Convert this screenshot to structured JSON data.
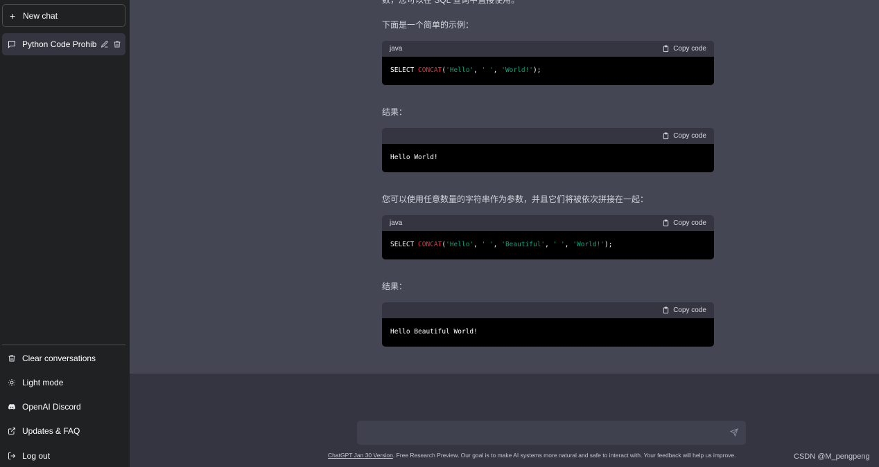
{
  "sidebar": {
    "new_chat_label": "New chat",
    "conversation_title": "Python Code Prohibit",
    "links": [
      {
        "label": "Clear conversations",
        "icon": "trash-icon"
      },
      {
        "label": "Light mode",
        "icon": "sun-icon"
      },
      {
        "label": "OpenAI Discord",
        "icon": "discord-icon"
      },
      {
        "label": "Updates & FAQ",
        "icon": "external-link-icon"
      },
      {
        "label": "Log out",
        "icon": "logout-icon"
      }
    ]
  },
  "main": {
    "partial_top_text": "数，您可以在 SQL 查询中直接使用。",
    "intro_example": "下面是一个简单的示例：",
    "result_label_1": "结果：",
    "multi_args_text": "您可以使用任意数量的字符串作为参数，并且它们将被依次拼接在一起：",
    "result_label_2": "结果：",
    "code_blocks": [
      {
        "lang": "java",
        "copy_label": "Copy code",
        "tokens": [
          {
            "t": "SELECT ",
            "c": "kw"
          },
          {
            "t": "CONCAT",
            "c": "fn"
          },
          {
            "t": "(",
            "c": "kw"
          },
          {
            "t": "'Hello'",
            "c": "str"
          },
          {
            "t": ", ",
            "c": "kw"
          },
          {
            "t": "' '",
            "c": "str"
          },
          {
            "t": ", ",
            "c": "kw"
          },
          {
            "t": "'World!'",
            "c": "str"
          },
          {
            "t": ");",
            "c": "kw"
          }
        ]
      },
      {
        "lang": "",
        "copy_label": "Copy code",
        "tokens": [
          {
            "t": "Hello World!",
            "c": "kw"
          }
        ]
      },
      {
        "lang": "java",
        "copy_label": "Copy code",
        "tokens": [
          {
            "t": "SELECT ",
            "c": "kw"
          },
          {
            "t": "CONCAT",
            "c": "fn"
          },
          {
            "t": "(",
            "c": "kw"
          },
          {
            "t": "'Hello'",
            "c": "str"
          },
          {
            "t": ", ",
            "c": "kw"
          },
          {
            "t": "' '",
            "c": "str"
          },
          {
            "t": ", ",
            "c": "kw"
          },
          {
            "t": "'Beautiful'",
            "c": "str"
          },
          {
            "t": ", ",
            "c": "kw"
          },
          {
            "t": "' '",
            "c": "str"
          },
          {
            "t": ", ",
            "c": "kw"
          },
          {
            "t": "'World!'",
            "c": "str"
          },
          {
            "t": ");",
            "c": "kw"
          }
        ]
      },
      {
        "lang": "",
        "copy_label": "Copy code",
        "tokens": [
          {
            "t": "Hello Beautiful World!",
            "c": "kw"
          }
        ]
      }
    ]
  },
  "footer": {
    "version_link": "ChatGPT Jan 30 Version",
    "note": ". Free Research Preview. Our goal is to make AI systems more natural and safe to interact with. Your feedback will help us improve.",
    "watermark": "CSDN @M_pengpeng"
  },
  "colors": {
    "sidebar_bg": "#202123",
    "main_bg": "#444654",
    "code_bg": "#000000",
    "keyword_fn": "#f22c3d",
    "string": "#00a67d"
  }
}
